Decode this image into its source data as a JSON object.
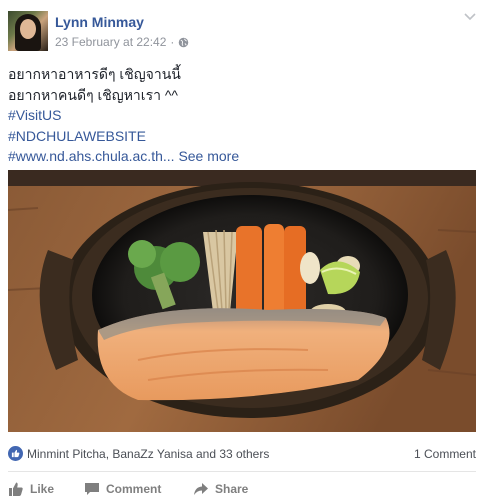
{
  "post": {
    "author": "Lynn Minmay",
    "timestamp": "23 February at 22:42",
    "separator": "·",
    "privacy_icon": "globe-icon",
    "options_icon": "chevron-down-icon",
    "text_lines": [
      "อยากหาอาหารดีๆ เชิญจานนี้",
      "อยากหาคนดีๆ เชิญหาเรา ^^"
    ],
    "hashtags": [
      "#VisitUS",
      "#NDCHULAWEBSITE"
    ],
    "link_line": "#www.nd.ahs.chula.ac.th...",
    "see_more": "See more"
  },
  "reactions": {
    "icon": "thumbs-up-icon",
    "names": "Minmint Pitcha, BanaZz Yanisa and 33 others",
    "comments": "1 Comment"
  },
  "actions": {
    "like": "Like",
    "comment": "Comment",
    "share": "Share"
  },
  "colors": {
    "link": "#365899",
    "meta": "#90949c",
    "like_badge": "#4267b2",
    "action": "#7f7f7f"
  }
}
